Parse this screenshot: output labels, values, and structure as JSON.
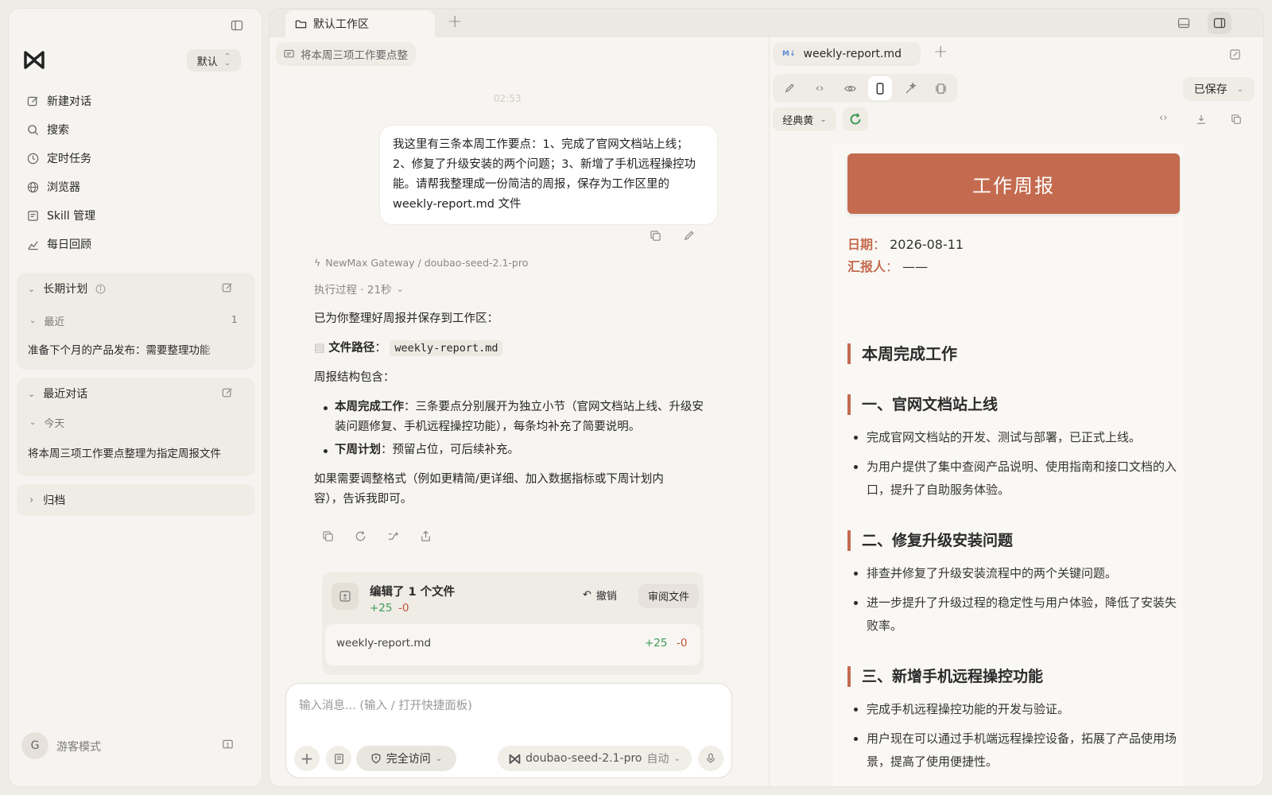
{
  "sidebar": {
    "mode_label": "默认",
    "nav": [
      {
        "label": "新建对话",
        "icon": "edit-icon"
      },
      {
        "label": "搜索",
        "icon": "search-icon"
      },
      {
        "label": "定时任务",
        "icon": "clock-icon"
      },
      {
        "label": "浏览器",
        "icon": "globe-icon"
      },
      {
        "label": "Skill 管理",
        "icon": "skill-icon"
      },
      {
        "label": "每日回顾",
        "icon": "chart-icon"
      }
    ],
    "long_term": {
      "title": "长期计划",
      "recent_label": "最近",
      "recent_count": "1",
      "item": "准备下个月的产品发布：需要整理功能"
    },
    "recent_chats": {
      "title": "最近对话",
      "today_label": "今天",
      "item": "将本周三项工作要点整理为指定周报文件"
    },
    "archive_label": "归档",
    "user": {
      "avatar_letter": "G",
      "name": "游客模式"
    }
  },
  "tabs": {
    "workspace": "默认工作区"
  },
  "chat": {
    "thread_title": "将本周三项工作要点整",
    "timestamp": "02:53",
    "user_message": "我这里有三条本周工作要点：1、完成了官网文档站上线；2、修复了升级安装的两个问题；3、新增了手机远程操控功能。请帮我整理成一份简洁的周报，保存为工作区里的 weekly-report.md 文件",
    "model_line": "NewMax Gateway / doubao-seed-2.1-pro",
    "process": "执行过程 · 21秒",
    "reply_intro": "已为你整理好周报并保存到工作区：",
    "file_path_label": "文件路径",
    "file_path_value": "weekly-report.md",
    "structure_label": "周报结构包含：",
    "bullet1_title": "本周完成工作",
    "bullet1_text": "：三条要点分别展开为独立小节（官网文档站上线、升级安装问题修复、手机远程操控功能），每条均补充了简要说明。",
    "bullet2_title": "下周计划",
    "bullet2_text": "：预留占位，可后续补充。",
    "closing": "如果需要调整格式（例如更精简/更详细、加入数据指标或下周计划内容），告诉我即可。",
    "edit_card": {
      "title": "编辑了 1 个文件",
      "plus": "+25",
      "minus": "-0",
      "undo": "撤销",
      "review": "审阅文件",
      "file": "weekly-report.md"
    },
    "composer": {
      "placeholder": "输入消息... (输入 / 打开快捷面板)",
      "access": "完全访问",
      "model": "doubao-seed-2.1-pro",
      "auto": "自动"
    }
  },
  "preview": {
    "file_tab": "weekly-report.md",
    "saved": "已保存",
    "theme": "经典黄",
    "doc": {
      "title": "工作周报",
      "date_label": "日期",
      "date_value": "2026-08-11",
      "reporter_label": "汇报人",
      "reporter_value": "——",
      "h_main": "本周完成工作",
      "s1": "一、官网文档站上线",
      "s1_b1": "完成官网文档站的开发、测试与部署，已正式上线。",
      "s1_b2": "为用户提供了集中查阅产品说明、使用指南和接口文档的入口，提升了自助服务体验。",
      "s2": "二、修复升级安装问题",
      "s2_b1": "排查并修复了升级安装流程中的两个关键问题。",
      "s2_b2": "进一步提升了升级过程的稳定性与用户体验，降低了安装失败率。",
      "s3": "三、新增手机远程操控功能",
      "s3_b1": "完成手机远程操控功能的开发与验证。",
      "s3_b2": "用户现在可以通过手机端远程操控设备，拓展了产品使用场景，提高了使用便捷性。"
    }
  },
  "colors": {
    "accent": "#c46b4f",
    "green": "#3e9a58",
    "red": "#c0553a"
  }
}
